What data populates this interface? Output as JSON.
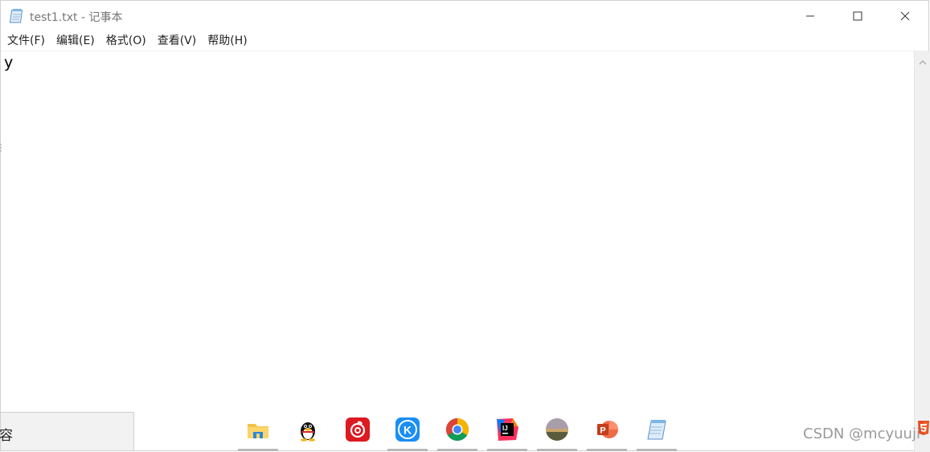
{
  "window": {
    "title": "test1.txt - 记事本"
  },
  "menu": {
    "items": [
      "文件(F)",
      "编辑(E)",
      "格式(O)",
      "查看(V)",
      "帮助(H)"
    ]
  },
  "editor": {
    "content": "y"
  },
  "overlay": {
    "text": "容"
  },
  "taskbar": {
    "icons": [
      "file-explorer-icon",
      "qq-icon",
      "netease-music-icon",
      "kugou-icon",
      "chrome-icon",
      "intellij-idea-icon",
      "photo-icon",
      "powerpoint-icon",
      "notepad-icon"
    ]
  },
  "watermark": {
    "text": "CSDN @mcyuuji"
  },
  "colors": {
    "title_text": "#777777",
    "menu_text": "#222222",
    "scrollbar_bg": "#f0f0f0",
    "taskbar_underline": "#b7b7b7"
  }
}
